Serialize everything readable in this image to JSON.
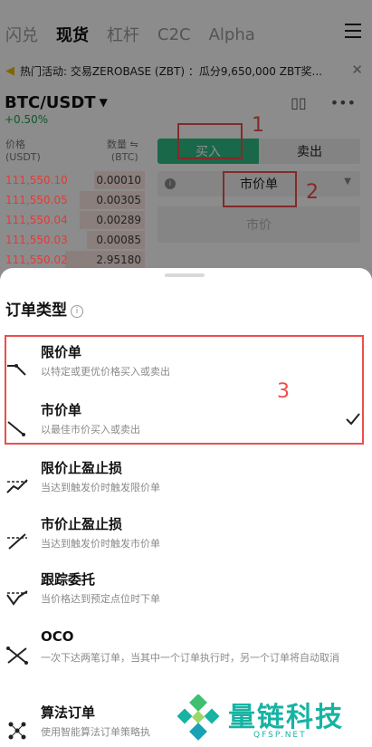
{
  "topnav": {
    "tabs": [
      "闪兑",
      "现货",
      "杠杆",
      "C2C",
      "Alpha"
    ],
    "active": "现货",
    "menu_icon": "hamburger-menu-icon"
  },
  "announcement": {
    "text": "热门活动: 交易ZEROBASE (ZBT) ：瓜分9,650,000 ZBT奖...",
    "close": "✕"
  },
  "pair": {
    "symbol": "BTC/USDT",
    "change": "+0.50%"
  },
  "orderbook": {
    "price_header": "价格",
    "price_unit": "(USDT)",
    "qty_header": "数量 ⇋",
    "qty_unit": "(BTC)",
    "rows": [
      {
        "price": "111,550.10",
        "qty": "0.00010",
        "depth": 0.35
      },
      {
        "price": "111,550.05",
        "qty": "0.00305",
        "depth": 0.45
      },
      {
        "price": "111,550.04",
        "qty": "0.00289",
        "depth": 0.45
      },
      {
        "price": "111,550.03",
        "qty": "0.00085",
        "depth": 0.4
      },
      {
        "price": "111,550.02",
        "qty": "2.95180",
        "depth": 0.55
      }
    ]
  },
  "trade": {
    "buy_label": "买入",
    "sell_label": "卖出",
    "order_type": "市价单",
    "price_placeholder": "市价"
  },
  "annotations": [
    "1",
    "2",
    "3"
  ],
  "sheet": {
    "title": "订单类型",
    "options": [
      {
        "name": "限价单",
        "desc": "以特定或更优价格买入或卖出",
        "icon": "limit-order-icon"
      },
      {
        "name": "市价单",
        "desc": "以最佳市价买入或卖出",
        "icon": "market-order-icon",
        "selected": true
      },
      {
        "name": "限价止盈止损",
        "desc": "当达到触发价时触发限价单",
        "icon": "stop-limit-icon"
      },
      {
        "name": "市价止盈止损",
        "desc": "当达到触发价时触发市价单",
        "icon": "stop-market-icon"
      },
      {
        "name": "跟踪委托",
        "desc": "当价格达到预定点位时下单",
        "icon": "trailing-stop-icon"
      },
      {
        "name": "OCO",
        "desc": "一次下达两笔订单，当其中一个订单执行时，另一个订单将自动取消",
        "icon": "oco-icon"
      },
      {
        "name": "算法订单",
        "desc": "使用智能算法订单策略执",
        "icon": "algo-order-icon"
      }
    ]
  },
  "watermark": {
    "text": "量链科技",
    "sub": "QFSP.NET"
  },
  "colors": {
    "buy_green": "#2ebd85",
    "ask_red": "#e53935",
    "annotation_red": "#ee4d4d",
    "watermark_teal": "#17b3a3"
  }
}
